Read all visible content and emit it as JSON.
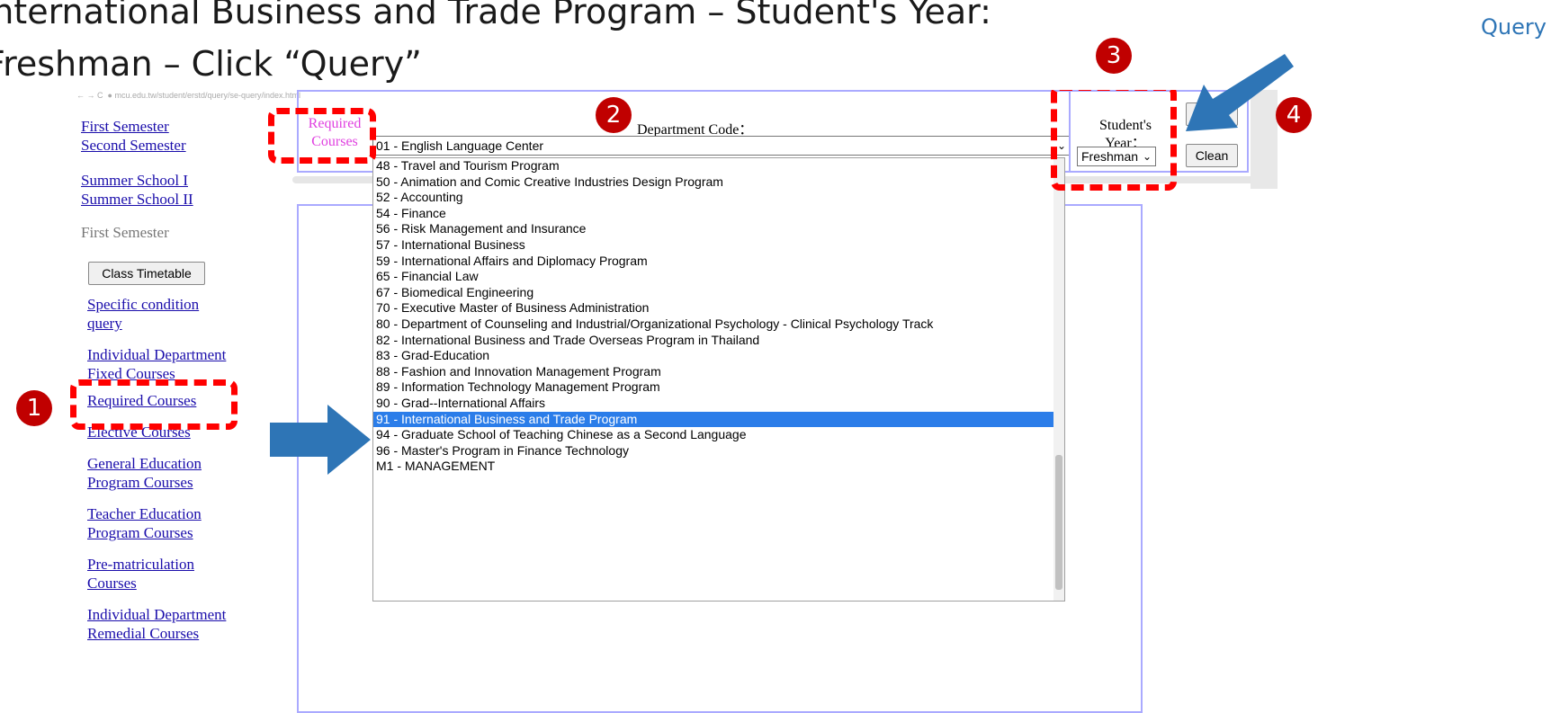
{
  "slide": {
    "title_line1": "International Business and Trade Program – Student's Year:",
    "title_line2": "Freshman – Click “Query”",
    "query_label": "Query",
    "badges": [
      "1",
      "2",
      "3",
      "4"
    ],
    "colors": {
      "badge": "#c00000",
      "arrow": "#2e75b6",
      "dashed_box": "#ff0000",
      "selected": "#2b7de9"
    }
  },
  "browser": {
    "address": "mcu.edu.tw/student/erstd/query/se-query/index.html"
  },
  "sidebar": {
    "links_top": [
      "First Semester",
      "Second Semester"
    ],
    "links_summer": [
      "Summer School I",
      "Summer School II"
    ],
    "section_label": "First Semester",
    "class_timetable_button": "Class Timetable",
    "items": [
      {
        "line1": "Specific condition",
        "line2": "query"
      },
      {
        "line1": "Individual Department",
        "line2": "Fixed Courses"
      },
      {
        "line1": "Required Courses",
        "line2": ""
      },
      {
        "line1": "Elective Courses",
        "line2": ""
      },
      {
        "line1": "General Education",
        "line2": "Program Courses"
      },
      {
        "line1": "Teacher Education",
        "line2": "Program Courses"
      },
      {
        "line1": "Pre-matriculation",
        "line2": "Courses"
      },
      {
        "line1": "Individual Department",
        "line2": "Remedial Courses"
      }
    ]
  },
  "form": {
    "mode_line1": "Required",
    "mode_line2": "Courses",
    "department_label": "Department Code：",
    "department_selected": "01 - English Language Center",
    "student_year_label_line1": "Student's",
    "student_year_label_line2": "Year：",
    "student_year_value": "Freshman",
    "query_button": "Query",
    "clean_button": "Clean"
  },
  "dropdown": {
    "options": [
      "48 - Travel and Tourism Program",
      "50 - Animation and Comic Creative Industries Design Program",
      "52 - Accounting",
      "54 - Finance",
      "56 - Risk Management and Insurance",
      "57 - International Business",
      "59 - International Affairs and Diplomacy Program",
      "65 - Financial Law",
      "67 - Biomedical Engineering",
      "70 - Executive Master of Business Administration",
      "80 - Department of Counseling and Industrial/Organizational Psychology - Clinical Psychology Track",
      "82 - International Business and Trade Overseas Program in Thailand",
      "83 - Grad-Education",
      "88 - Fashion and Innovation Management Program",
      "89 - Information Technology Management Program",
      "90 - Grad--International Affairs",
      "91 - International Business and Trade Program",
      "94 - Graduate School of Teaching Chinese as a Second Language",
      "96 - Master's Program in Finance Technology",
      "M1 - MANAGEMENT"
    ],
    "selected_index": 16
  }
}
